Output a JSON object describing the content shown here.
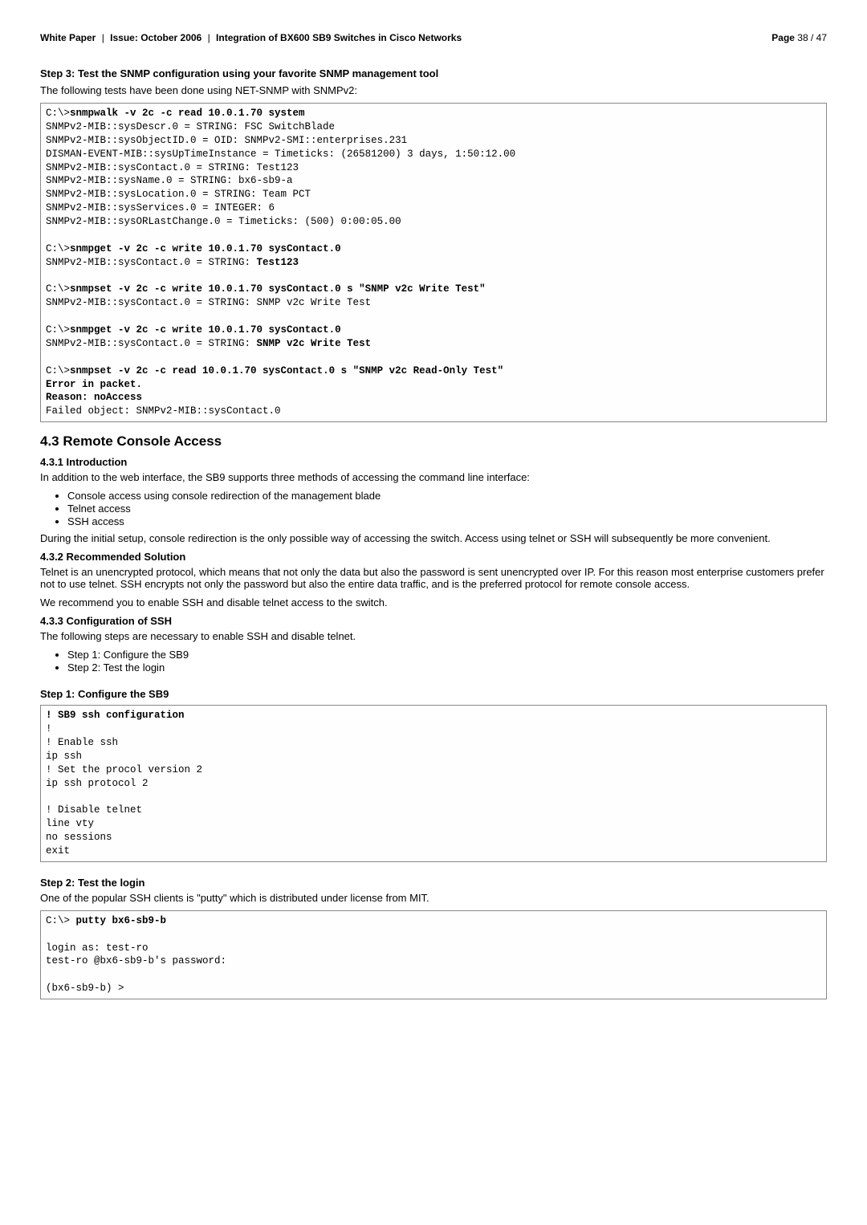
{
  "header": {
    "white_paper": "White Paper",
    "issue": "Issue: October 2006",
    "title": "Integration of BX600 SB9 Switches in Cisco Networks",
    "page_label": "Page",
    "page_val": "38 / 47"
  },
  "step3": {
    "heading": "Step 3: Test the SNMP configuration using your favorite SNMP management tool",
    "intro": "The following tests have been done using NET-SNMP with SNMPv2:"
  },
  "code1": {
    "l1a": "C:\\>",
    "l1b": "snmpwalk -v 2c -c read 10.0.1.70 system",
    "l2": "SNMPv2-MIB::sysDescr.0 = STRING: FSC SwitchBlade",
    "l3": "SNMPv2-MIB::sysObjectID.0 = OID: SNMPv2-SMI::enterprises.231",
    "l4": "DISMAN-EVENT-MIB::sysUpTimeInstance = Timeticks: (26581200) 3 days, 1:50:12.00",
    "l5": "SNMPv2-MIB::sysContact.0 = STRING: Test123",
    "l6": "SNMPv2-MIB::sysName.0 = STRING: bx6-sb9-a",
    "l7": "SNMPv2-MIB::sysLocation.0 = STRING: Team PCT",
    "l8": "SNMPv2-MIB::sysServices.0 = INTEGER: 6",
    "l9": "SNMPv2-MIB::sysORLastChange.0 = Timeticks: (500) 0:00:05.00",
    "l10a": "C:\\>",
    "l10b": "snmpget -v 2c -c write 10.0.1.70 sysContact.0",
    "l11a": "SNMPv2-MIB::sysContact.0 = STRING: ",
    "l11b": "Test123",
    "l12a": "C:\\>",
    "l12b": "snmpset -v 2c -c write 10.0.1.70 sysContact.0 s \"SNMP v2c Write Test\"",
    "l13": "SNMPv2-MIB::sysContact.0 = STRING: SNMP v2c Write Test",
    "l14a": "C:\\>",
    "l14b": "snmpget -v 2c -c write 10.0.1.70 sysContact.0",
    "l15a": "SNMPv2-MIB::sysContact.0 = STRING: ",
    "l15b": "SNMP v2c Write Test",
    "l16a": "C:\\>",
    "l16b": "snmpset -v 2c -c read 10.0.1.70 sysContact.0 s \"SNMP v2c Read-Only Test\"",
    "l17": "Error in packet.",
    "l18": "Reason: noAccess",
    "l19": "Failed object: SNMPv2-MIB::sysContact.0"
  },
  "sec43": {
    "heading": "4.3   Remote Console Access",
    "s431_h": "4.3.1   Introduction",
    "s431_p": "In addition to the web interface, the SB9 supports three methods of accessing the command line interface:",
    "s431_b1": "Console access using console redirection of the management blade",
    "s431_b2": "Telnet access",
    "s431_b3": "SSH access",
    "s431_p2": "During the initial setup, console redirection is the only possible way of accessing the switch. Access using telnet or SSH will subsequently be more convenient.",
    "s432_h": "4.3.2   Recommended Solution",
    "s432_p1": "Telnet is an unencrypted protocol, which means that not only the data but also the password is sent unencrypted over IP. For this reason most enterprise customers prefer not to use telnet. SSH encrypts not only the password but also the entire data traffic, and is the preferred protocol for remote console access.",
    "s432_p2": "We recommend you to enable SSH and disable telnet access to the switch.",
    "s433_h": "4.3.3   Configuration of SSH",
    "s433_p": "The following steps are necessary to enable SSH and disable telnet.",
    "s433_b1": "Step 1: Configure the SB9",
    "s433_b2": "Step 2: Test the login"
  },
  "step1": {
    "heading": "Step 1:  Configure the SB9"
  },
  "code2": {
    "l1": "! SB9 ssh configuration",
    "l2": "!",
    "l3": "! Enable ssh",
    "l4": "ip ssh",
    "l5": "! Set the procol version 2",
    "l6": "ip ssh protocol 2",
    "l7": "",
    "l8": "! Disable telnet",
    "l9": "line vty",
    "l10": "no sessions",
    "l11": "exit"
  },
  "step2": {
    "heading": "Step 2: Test the login",
    "intro": "One of the popular SSH clients is \"putty\" which is distributed under license from MIT."
  },
  "code3": {
    "l1a": "C:\\> ",
    "l1b": "putty bx6-sb9-b",
    "l2": "",
    "l3": "login as: test-ro",
    "l4": "test-ro @bx6-sb9-b's password:",
    "l5": "",
    "l6": "(bx6-sb9-b) >"
  }
}
